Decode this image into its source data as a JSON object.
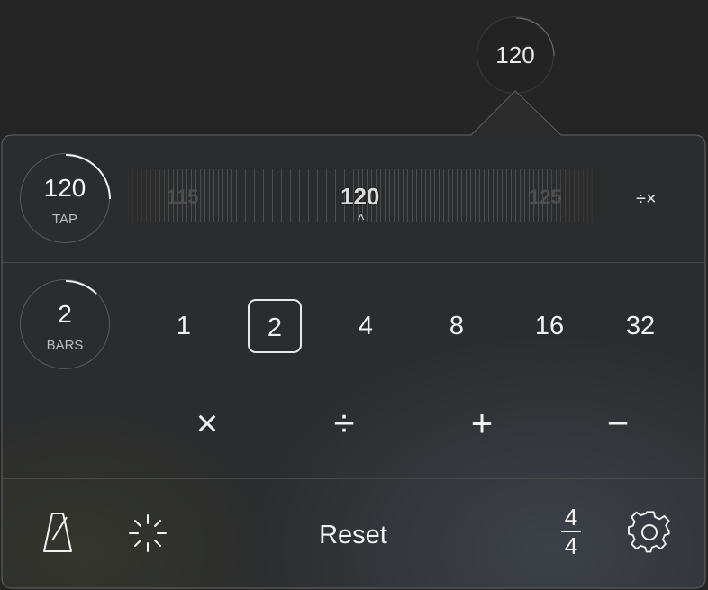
{
  "header": {
    "bpm_display": "120"
  },
  "tempo": {
    "tap_value": "120",
    "tap_label": "TAP",
    "ruler_ticks": [
      "115",
      "120",
      "125"
    ],
    "caret": "^",
    "adjust_label": "÷×"
  },
  "bars": {
    "value": "2",
    "label": "BARS",
    "options": [
      "1",
      "2",
      "4",
      "8",
      "16",
      "32"
    ],
    "selected": "2",
    "operators": [
      "×",
      "÷",
      "+",
      "−"
    ]
  },
  "footer": {
    "reset_label": "Reset",
    "time_signature_top": "4",
    "time_signature_bottom": "4",
    "icons": [
      "metronome-icon",
      "flash-icon",
      "gear-icon"
    ]
  }
}
